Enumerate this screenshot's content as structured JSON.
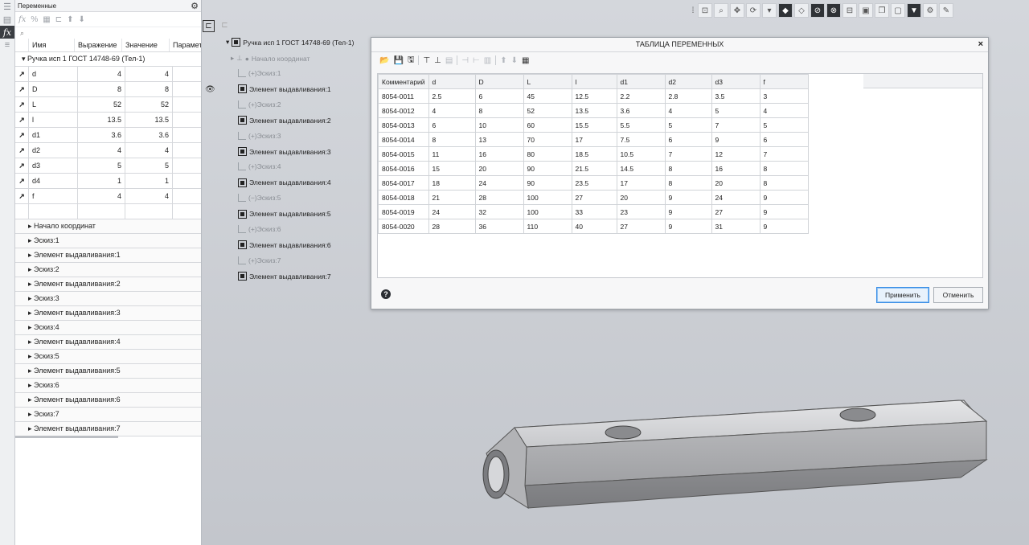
{
  "panel": {
    "title": "Переменные",
    "search_placeholder": "",
    "columns": [
      "Имя",
      "Выражение",
      "Значение",
      "Парамет"
    ],
    "group": "Ручка исп 1 ГОСТ 14748-69 (Тел-1)",
    "rows": [
      {
        "name": "d",
        "expr": "4",
        "value": "4"
      },
      {
        "name": "D",
        "expr": "8",
        "value": "8"
      },
      {
        "name": "L",
        "expr": "52",
        "value": "52"
      },
      {
        "name": "l",
        "expr": "13.5",
        "value": "13.5"
      },
      {
        "name": "d1",
        "expr": "3.6",
        "value": "3.6"
      },
      {
        "name": "d2",
        "expr": "4",
        "value": "4"
      },
      {
        "name": "d3",
        "expr": "5",
        "value": "5"
      },
      {
        "name": "d4",
        "expr": "1",
        "value": "1"
      },
      {
        "name": "f",
        "expr": "4",
        "value": "4"
      },
      {
        "name": "",
        "expr": "",
        "value": ""
      }
    ],
    "features": [
      "Начало координат",
      "Эскиз:1",
      "Элемент выдавливания:1",
      "Эскиз:2",
      "Элемент выдавливания:2",
      "Эскиз:3",
      "Элемент выдавливания:3",
      "Эскиз:4",
      "Элемент выдавливания:4",
      "Эскиз:5",
      "Элемент выдавливания:5",
      "Эскиз:6",
      "Элемент выдавливания:6",
      "Эскиз:7",
      "Элемент выдавливания:7"
    ]
  },
  "tree": {
    "root": "Ручка исп 1 ГОСТ 14748-69 (Тел-1)",
    "origin": "Начало координат",
    "items": [
      {
        "label": "(+)Эскиз:1",
        "kind": "sketch"
      },
      {
        "label": "Элемент выдавливания:1",
        "kind": "extrude"
      },
      {
        "label": "(+)Эскиз:2",
        "kind": "sketch"
      },
      {
        "label": "Элемент выдавливания:2",
        "kind": "extrude"
      },
      {
        "label": "(+)Эскиз:3",
        "kind": "sketch"
      },
      {
        "label": "Элемент выдавливания:3",
        "kind": "extrude"
      },
      {
        "label": "(+)Эскиз:4",
        "kind": "sketch"
      },
      {
        "label": "Элемент выдавливания:4",
        "kind": "extrude"
      },
      {
        "label": "(−)Эскиз:5",
        "kind": "sketch"
      },
      {
        "label": "Элемент выдавливания:5",
        "kind": "extrude"
      },
      {
        "label": "(+)Эскиз:6",
        "kind": "sketch"
      },
      {
        "label": "Элемент выдавливания:6",
        "kind": "extrude"
      },
      {
        "label": "(+)Эскиз:7",
        "kind": "sketch"
      },
      {
        "label": "Элемент выдавливания:7",
        "kind": "extrude"
      }
    ]
  },
  "dialog": {
    "title": "ТАБЛИЦА ПЕРЕМЕННЫХ",
    "close": "×",
    "columns": [
      "Комментарий",
      "d",
      "D",
      "L",
      "l",
      "d1",
      "d2",
      "d3",
      "f"
    ],
    "rows": [
      [
        "8054-0011",
        "2.5",
        "6",
        "45",
        "12.5",
        "2.2",
        "2.8",
        "3.5",
        "3"
      ],
      [
        "8054-0012",
        "4",
        "8",
        "52",
        "13.5",
        "3.6",
        "4",
        "5",
        "4"
      ],
      [
        "8054-0013",
        "6",
        "10",
        "60",
        "15.5",
        "5.5",
        "5",
        "7",
        "5"
      ],
      [
        "8054-0014",
        "8",
        "13",
        "70",
        "17",
        "7.5",
        "6",
        "9",
        "6"
      ],
      [
        "8054-0015",
        "11",
        "16",
        "80",
        "18.5",
        "10.5",
        "7",
        "12",
        "7"
      ],
      [
        "8054-0016",
        "15",
        "20",
        "90",
        "21.5",
        "14.5",
        "8",
        "16",
        "8"
      ],
      [
        "8054-0017",
        "18",
        "24",
        "90",
        "23.5",
        "17",
        "8",
        "20",
        "8"
      ],
      [
        "8054-0018",
        "21",
        "28",
        "100",
        "27",
        "20",
        "9",
        "24",
        "9"
      ],
      [
        "8054-0019",
        "24",
        "32",
        "100",
        "33",
        "23",
        "9",
        "27",
        "9"
      ],
      [
        "8054-0020",
        "28",
        "36",
        "110",
        "40",
        "27",
        "9",
        "31",
        "9"
      ]
    ],
    "help": "?",
    "apply": "Применить",
    "cancel": "Отменить"
  },
  "colors": {
    "accent": "#3a8ee6",
    "dark_icon": "#2f3236"
  }
}
